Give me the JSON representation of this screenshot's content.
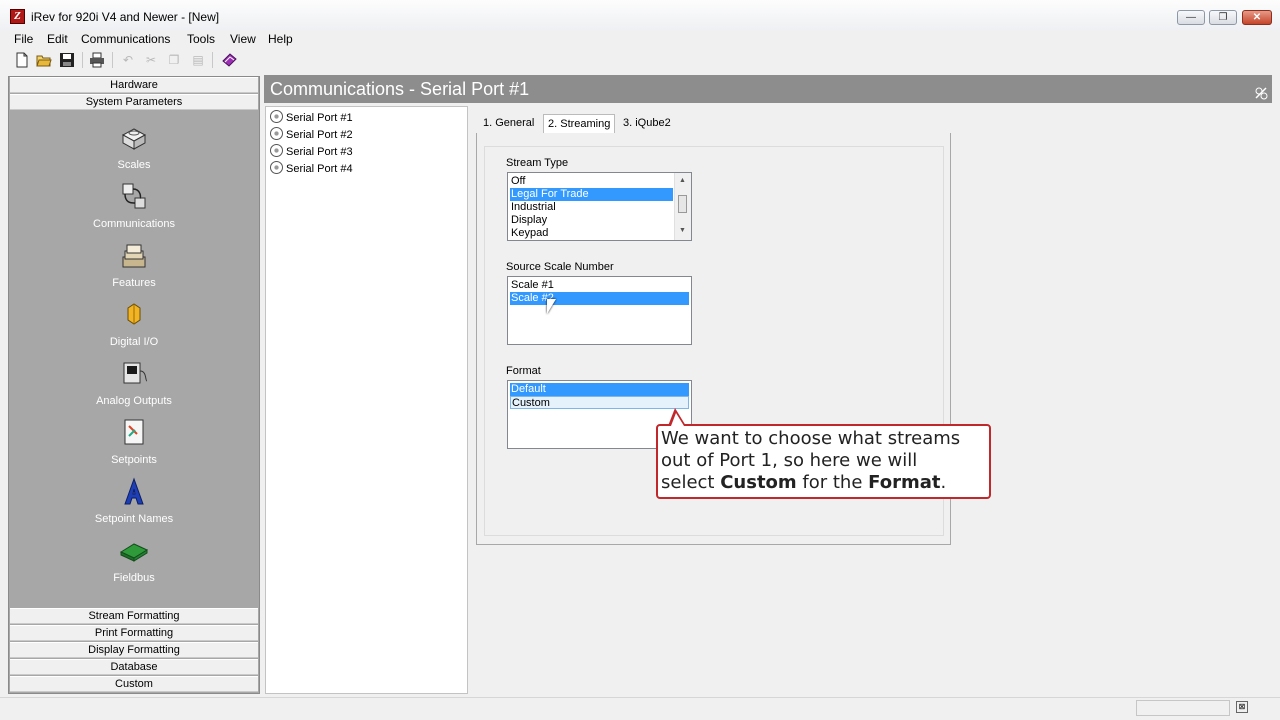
{
  "window": {
    "title": "iRev for 920i V4 and Newer - [New]",
    "minimize": "—",
    "maximize": "❐",
    "close": "✕"
  },
  "menu": [
    "File",
    "Edit",
    "Communications",
    "Tools",
    "View",
    "Help"
  ],
  "toolbar_icons": [
    "new-icon",
    "open-icon",
    "save-icon",
    "print-icon",
    "undo-icon",
    "cut-icon",
    "copy-icon",
    "paste-icon",
    "book-icon"
  ],
  "left_panel": {
    "top_sections": [
      "Hardware",
      "System Parameters"
    ],
    "nav_items": [
      "Scales",
      "Communications",
      "Features",
      "Digital I/O",
      "Analog Outputs",
      "Setpoints",
      "Setpoint Names",
      "Fieldbus"
    ],
    "bottom_sections": [
      "Stream Formatting",
      "Print Formatting",
      "Display Formatting",
      "Database",
      "Custom"
    ]
  },
  "page": {
    "header": "Communications - Serial Port #1"
  },
  "tree": [
    "Serial Port #1",
    "Serial Port #2",
    "Serial Port #3",
    "Serial Port #4"
  ],
  "tabs": [
    "1. General",
    "2. Streaming",
    "3. iQube2"
  ],
  "active_tab": "2. Streaming",
  "stream_type": {
    "label": "Stream Type",
    "options": [
      "Off",
      "Legal For Trade",
      "Industrial",
      "Display",
      "Keypad"
    ],
    "selected": "Legal For Trade"
  },
  "source_scale": {
    "label": "Source Scale Number",
    "options": [
      "Scale #1",
      "Scale #2"
    ],
    "selected": "Scale #2"
  },
  "format": {
    "label": "Format",
    "options": [
      "Default",
      "Custom"
    ],
    "selected": "Default"
  },
  "callout": {
    "line1": "We want to choose what streams",
    "line2": "out of Port 1, so here we will",
    "line3_a": "select ",
    "line3_b": "Custom",
    "line3_c": " for the ",
    "line3_d": "Format",
    "line3_e": "."
  },
  "colors": {
    "selection": "#3399ff",
    "panel_gray": "#a7a7a7",
    "header_gray": "#8d8d8d",
    "callout_border": "#c0282c"
  }
}
